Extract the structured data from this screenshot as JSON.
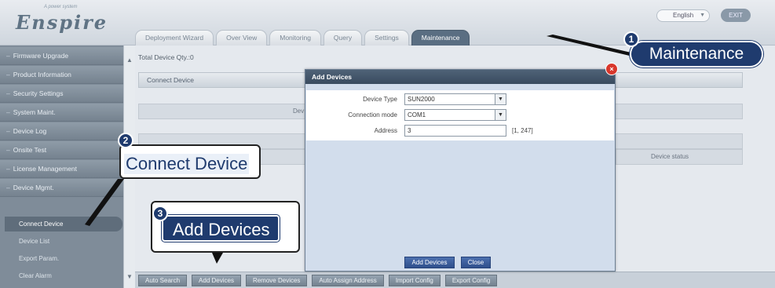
{
  "header": {
    "logo_tagline": "A power system",
    "logo": "Enspire",
    "language": "English",
    "logout_label": "EXIT"
  },
  "tabs": [
    "Deployment Wizard",
    "Over View",
    "Monitoring",
    "Query",
    "Settings",
    "Maintenance"
  ],
  "sidebar": {
    "items": [
      "Firmware Upgrade",
      "Product Information",
      "Security Settings",
      "System Maint.",
      "Device Log",
      "Onsite Test",
      "License Management",
      "Device Mgmt."
    ],
    "subitems": [
      "Connect Device",
      "Device List",
      "Export Param.",
      "Clear Alarm"
    ]
  },
  "main": {
    "total_label": "Total Device Qty.:0",
    "table_header": "Connect Device",
    "band_label": "Dev",
    "status_header": "Device status"
  },
  "dialog": {
    "title": "Add Devices",
    "fields": [
      {
        "label": "Device Type",
        "value": "SUN2000"
      },
      {
        "label": "Connection mode",
        "value": "COM1"
      },
      {
        "label": "Address",
        "value": "3",
        "hint": "[1, 247]"
      }
    ],
    "add_button": "Add Devices",
    "close_button": "Close"
  },
  "bottom_buttons": [
    "Auto Search",
    "Add Devices",
    "Remove Devices",
    "Auto Assign Address",
    "Import Config",
    "Export Config"
  ],
  "callouts": [
    {
      "number": "1",
      "text": "Maintenance"
    },
    {
      "number": "2",
      "text": "Connect Device"
    },
    {
      "number": "3",
      "text": "Add Devices"
    }
  ],
  "colors": {
    "callout_fill": "#1f3b6e",
    "dialog_title": "#44576c",
    "close_red": "#d8372c"
  }
}
